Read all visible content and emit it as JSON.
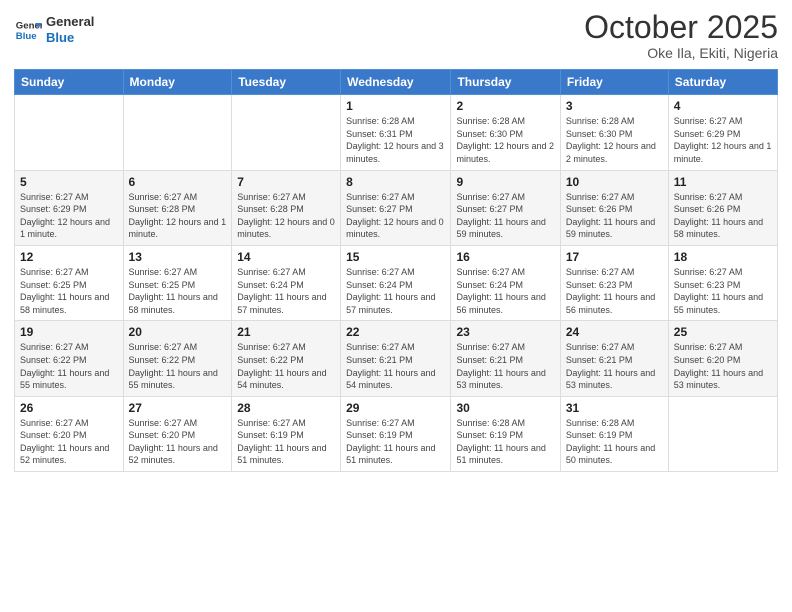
{
  "header": {
    "logo_general": "General",
    "logo_blue": "Blue",
    "title": "October 2025",
    "subtitle": "Oke Ila, Ekiti, Nigeria"
  },
  "days_of_week": [
    "Sunday",
    "Monday",
    "Tuesday",
    "Wednesday",
    "Thursday",
    "Friday",
    "Saturday"
  ],
  "weeks": [
    [
      {
        "day": "",
        "info": ""
      },
      {
        "day": "",
        "info": ""
      },
      {
        "day": "",
        "info": ""
      },
      {
        "day": "1",
        "info": "Sunrise: 6:28 AM\nSunset: 6:31 PM\nDaylight: 12 hours and 3 minutes."
      },
      {
        "day": "2",
        "info": "Sunrise: 6:28 AM\nSunset: 6:30 PM\nDaylight: 12 hours and 2 minutes."
      },
      {
        "day": "3",
        "info": "Sunrise: 6:28 AM\nSunset: 6:30 PM\nDaylight: 12 hours and 2 minutes."
      },
      {
        "day": "4",
        "info": "Sunrise: 6:27 AM\nSunset: 6:29 PM\nDaylight: 12 hours and 1 minute."
      }
    ],
    [
      {
        "day": "5",
        "info": "Sunrise: 6:27 AM\nSunset: 6:29 PM\nDaylight: 12 hours and 1 minute."
      },
      {
        "day": "6",
        "info": "Sunrise: 6:27 AM\nSunset: 6:28 PM\nDaylight: 12 hours and 1 minute."
      },
      {
        "day": "7",
        "info": "Sunrise: 6:27 AM\nSunset: 6:28 PM\nDaylight: 12 hours and 0 minutes."
      },
      {
        "day": "8",
        "info": "Sunrise: 6:27 AM\nSunset: 6:27 PM\nDaylight: 12 hours and 0 minutes."
      },
      {
        "day": "9",
        "info": "Sunrise: 6:27 AM\nSunset: 6:27 PM\nDaylight: 11 hours and 59 minutes."
      },
      {
        "day": "10",
        "info": "Sunrise: 6:27 AM\nSunset: 6:26 PM\nDaylight: 11 hours and 59 minutes."
      },
      {
        "day": "11",
        "info": "Sunrise: 6:27 AM\nSunset: 6:26 PM\nDaylight: 11 hours and 58 minutes."
      }
    ],
    [
      {
        "day": "12",
        "info": "Sunrise: 6:27 AM\nSunset: 6:25 PM\nDaylight: 11 hours and 58 minutes."
      },
      {
        "day": "13",
        "info": "Sunrise: 6:27 AM\nSunset: 6:25 PM\nDaylight: 11 hours and 58 minutes."
      },
      {
        "day": "14",
        "info": "Sunrise: 6:27 AM\nSunset: 6:24 PM\nDaylight: 11 hours and 57 minutes."
      },
      {
        "day": "15",
        "info": "Sunrise: 6:27 AM\nSunset: 6:24 PM\nDaylight: 11 hours and 57 minutes."
      },
      {
        "day": "16",
        "info": "Sunrise: 6:27 AM\nSunset: 6:24 PM\nDaylight: 11 hours and 56 minutes."
      },
      {
        "day": "17",
        "info": "Sunrise: 6:27 AM\nSunset: 6:23 PM\nDaylight: 11 hours and 56 minutes."
      },
      {
        "day": "18",
        "info": "Sunrise: 6:27 AM\nSunset: 6:23 PM\nDaylight: 11 hours and 55 minutes."
      }
    ],
    [
      {
        "day": "19",
        "info": "Sunrise: 6:27 AM\nSunset: 6:22 PM\nDaylight: 11 hours and 55 minutes."
      },
      {
        "day": "20",
        "info": "Sunrise: 6:27 AM\nSunset: 6:22 PM\nDaylight: 11 hours and 55 minutes."
      },
      {
        "day": "21",
        "info": "Sunrise: 6:27 AM\nSunset: 6:22 PM\nDaylight: 11 hours and 54 minutes."
      },
      {
        "day": "22",
        "info": "Sunrise: 6:27 AM\nSunset: 6:21 PM\nDaylight: 11 hours and 54 minutes."
      },
      {
        "day": "23",
        "info": "Sunrise: 6:27 AM\nSunset: 6:21 PM\nDaylight: 11 hours and 53 minutes."
      },
      {
        "day": "24",
        "info": "Sunrise: 6:27 AM\nSunset: 6:21 PM\nDaylight: 11 hours and 53 minutes."
      },
      {
        "day": "25",
        "info": "Sunrise: 6:27 AM\nSunset: 6:20 PM\nDaylight: 11 hours and 53 minutes."
      }
    ],
    [
      {
        "day": "26",
        "info": "Sunrise: 6:27 AM\nSunset: 6:20 PM\nDaylight: 11 hours and 52 minutes."
      },
      {
        "day": "27",
        "info": "Sunrise: 6:27 AM\nSunset: 6:20 PM\nDaylight: 11 hours and 52 minutes."
      },
      {
        "day": "28",
        "info": "Sunrise: 6:27 AM\nSunset: 6:19 PM\nDaylight: 11 hours and 51 minutes."
      },
      {
        "day": "29",
        "info": "Sunrise: 6:27 AM\nSunset: 6:19 PM\nDaylight: 11 hours and 51 minutes."
      },
      {
        "day": "30",
        "info": "Sunrise: 6:28 AM\nSunset: 6:19 PM\nDaylight: 11 hours and 51 minutes."
      },
      {
        "day": "31",
        "info": "Sunrise: 6:28 AM\nSunset: 6:19 PM\nDaylight: 11 hours and 50 minutes."
      },
      {
        "day": "",
        "info": ""
      }
    ]
  ]
}
